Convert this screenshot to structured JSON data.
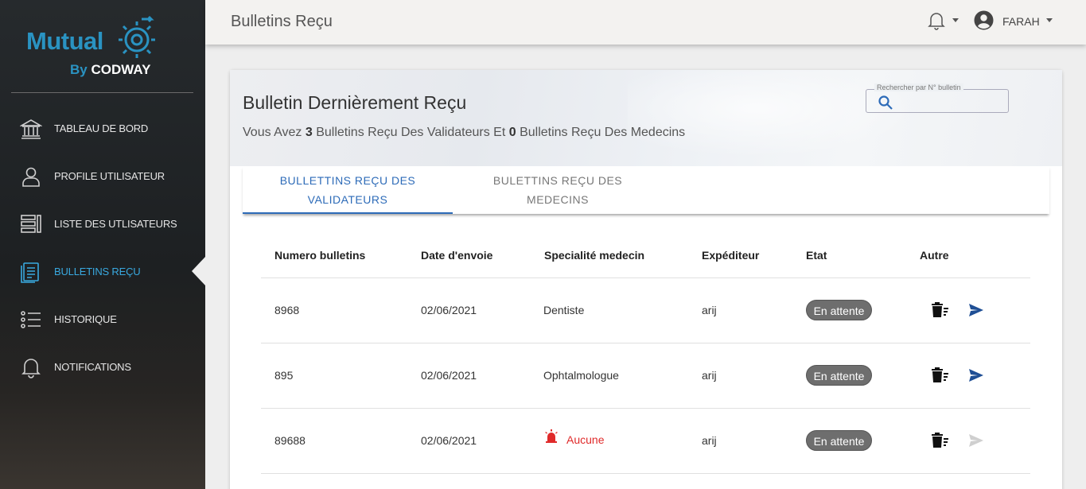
{
  "brand": {
    "name": "Mutual",
    "by": "By",
    "company": "CODWAY"
  },
  "sidebar": {
    "items": [
      {
        "label": "TABLEAU DE BORD",
        "icon": "bank-icon"
      },
      {
        "label": "PROFILE UTILISATEUR",
        "icon": "user-icon"
      },
      {
        "label": "LISTE DES UTLISATEURS",
        "icon": "list-icon"
      },
      {
        "label": "BULLETINS REÇU",
        "icon": "document-icon",
        "active": true
      },
      {
        "label": "HISTORIQUE",
        "icon": "checklist-icon"
      },
      {
        "label": "NOTIFICATIONS",
        "icon": "bell-icon"
      }
    ]
  },
  "header": {
    "title": "Bulletins Reçu",
    "user": "FARAH"
  },
  "card": {
    "title": "Bulletin Dernièrement Reçu",
    "subtitle": {
      "prefix": "Vous Avez ",
      "validators_count": "3",
      "middle": " Bulletins Reçu Des Validateurs Et ",
      "doctors_count": "0",
      "suffix": " Bulletins Reçu Des Medecins"
    },
    "search": {
      "label": "Rechercher par N° bulletin",
      "value": ""
    }
  },
  "tabs": [
    {
      "line1": "BULLETTINS REÇU DES",
      "line2": "VALIDATEURS",
      "active": true
    },
    {
      "line1": "BULETTINS REÇU DES",
      "line2": "MEDECINS",
      "active": false
    }
  ],
  "table": {
    "headers": [
      "Numero bulletins",
      "Date d'envoie",
      "Specialité medecin",
      "Expéditeur",
      "Etat",
      "Autre"
    ],
    "rows": [
      {
        "numero": "8968",
        "date": "02/06/2021",
        "specialite": "Dentiste",
        "expediteur": "arij",
        "etat": "En attente",
        "send_enabled": true,
        "alert": false
      },
      {
        "numero": "895",
        "date": "02/06/2021",
        "specialite": "Ophtalmologue",
        "expediteur": "arij",
        "etat": "En attente",
        "send_enabled": true,
        "alert": false
      },
      {
        "numero": "89688",
        "date": "02/06/2021",
        "specialite": "Aucune",
        "expediteur": "arij",
        "etat": "En attente",
        "send_enabled": false,
        "alert": true
      }
    ]
  },
  "colors": {
    "accent": "#2d6bb8",
    "sidebar_active": "#39a9e0",
    "alert": "#e02a2a",
    "badge": "#6e6e6e"
  }
}
